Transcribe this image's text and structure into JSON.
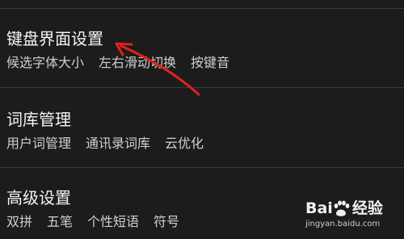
{
  "settings": [
    {
      "title": "键盘界面设置",
      "subs": [
        "候选字体大小",
        "左右滑动切换",
        "按键音"
      ]
    },
    {
      "title": "词库管理",
      "subs": [
        "用户词管理",
        "通讯录词库",
        "云优化"
      ]
    },
    {
      "title": "高级设置",
      "subs": [
        "双拼",
        "五笔",
        "个性短语",
        "符号"
      ]
    }
  ],
  "watermark": {
    "brand_left": "Bai",
    "brand_right": "经验",
    "url": "jingyan.baidu.com"
  },
  "colors": {
    "background": "#1c1c1c",
    "divider": "#3c3c3c",
    "title": "#f4f4f4",
    "subtitle": "#cfcfcf",
    "annotation_arrow": "#e0211f"
  },
  "icons": [
    "paw-icon",
    "arrow-annotation-icon"
  ]
}
